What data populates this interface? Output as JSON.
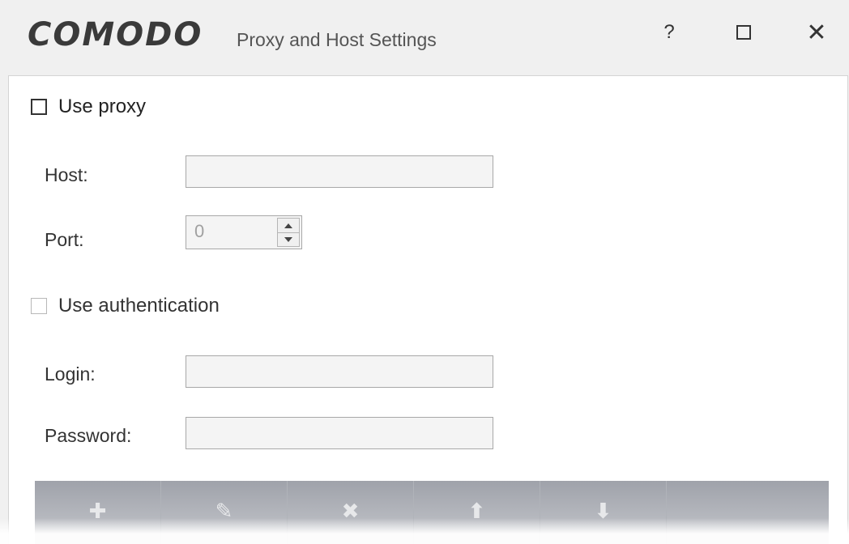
{
  "window": {
    "logo": "COMODO",
    "title": "Proxy and Host Settings",
    "help_label": "?",
    "close_label": "✕"
  },
  "proxy": {
    "use_proxy_label": "Use proxy",
    "use_proxy_checked": false,
    "host_label": "Host:",
    "host_value": "",
    "port_label": "Port:",
    "port_value": "0"
  },
  "auth": {
    "use_auth_label": "Use authentication",
    "use_auth_checked": false,
    "login_label": "Login:",
    "login_value": "",
    "password_label": "Password:",
    "password_value": ""
  },
  "toolbar": {
    "buttons": [
      {
        "icon": "plus-icon",
        "glyph": "✚"
      },
      {
        "icon": "pencil-icon",
        "glyph": "✎"
      },
      {
        "icon": "delete-icon",
        "glyph": "✖"
      },
      {
        "icon": "arrow-up-icon",
        "glyph": "⬆"
      },
      {
        "icon": "arrow-down-icon",
        "glyph": "⬇"
      },
      {
        "icon": "",
        "glyph": ""
      }
    ]
  }
}
